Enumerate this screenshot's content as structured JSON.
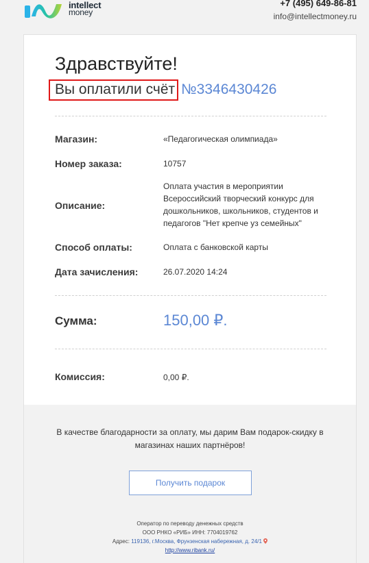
{
  "header": {
    "logo_line1": "intellect",
    "logo_line2": "money",
    "phone": "+7 (495) 649-86-81",
    "email": "info@intellectmoney.ru"
  },
  "receipt": {
    "greeting": "Здравствуйте!",
    "paid_text": "Вы оплатили счёт",
    "invoice_number": "№3346430426",
    "rows": [
      {
        "label": "Магазин:",
        "value": "«Педагогическая олимпиада»"
      },
      {
        "label": "Номер заказа:",
        "value": "10757"
      },
      {
        "label": "Описание:",
        "value": "Оплата участия в мероприятии Всероссийский творческий конкурс для дошкольников, школьников, студентов и педагогов \"Нет крепче уз семейных\""
      },
      {
        "label": "Способ оплаты:",
        "value": "Оплата с банковской карты"
      },
      {
        "label": "Дата зачисления:",
        "value": "26.07.2020 14:24"
      }
    ],
    "sum_label": "Сумма:",
    "sum_value": "150,00 ₽.",
    "commission_label": "Комиссия:",
    "commission_value": "0,00 ₽."
  },
  "gift": {
    "text": "В качестве благодарности за оплату, мы дарим Вам подарок-скидку в магазинах наших партнёров!",
    "button_label": "Получить подарок"
  },
  "footer": {
    "line1": "Оператор по переводу денежных средств",
    "line2": "ООО РНКО «РИБ» ИНН: 7704019762",
    "address_prefix": "Адрес: ",
    "address": "119136, г.Москва, Фрунзенская набережная, д. 24/1",
    "url": "http://www.ribank.ru/"
  },
  "colors": {
    "accent": "#5b87d4",
    "highlight_border": "#e01818",
    "card_bg": "#ffffff",
    "page_bg": "#f2f2f2"
  }
}
